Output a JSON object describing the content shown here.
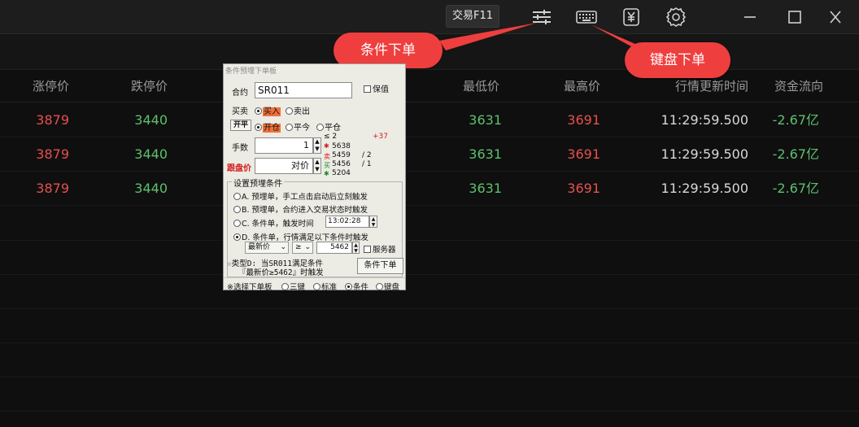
{
  "titlebar": {
    "trade_label": "交易F11",
    "icons": [
      "conditional-order-icon",
      "keyboard-icon",
      "yen-icon",
      "settings-icon",
      "minimize-icon",
      "maximize-icon",
      "close-icon"
    ]
  },
  "callouts": {
    "conditional": "条件下单",
    "keyboard": "键盘下单"
  },
  "table": {
    "headers": {
      "limit_up": "涨停价",
      "limit_down": "跌停价",
      "low": "最低价",
      "high": "最高价",
      "update_time": "行情更新时间",
      "fund_flow": "资金流向"
    },
    "rows": [
      {
        "limit_up": "3879",
        "limit_down": "3440",
        "low": "3631",
        "high": "3691",
        "update_time": "11:29:59.500",
        "fund_flow": "-2.67亿"
      },
      {
        "limit_up": "3879",
        "limit_down": "3440",
        "low": "3631",
        "high": "3691",
        "update_time": "11:29:59.500",
        "fund_flow": "-2.67亿"
      },
      {
        "limit_up": "3879",
        "limit_down": "3440",
        "low": "3631",
        "high": "3691",
        "update_time": "11:29:59.500",
        "fund_flow": "-2.67亿"
      }
    ]
  },
  "dialog": {
    "title": "条件预埋下单板",
    "contract_label": "合约",
    "contract_value": "SR011",
    "keep_label": "保值",
    "side_label": "买卖",
    "buy": "买入",
    "sell": "卖出",
    "open_btn": "开平",
    "open": "开仓",
    "close_today": "平今",
    "close": "平仓",
    "qty_label": "手数",
    "qty_value": "1",
    "price_btn": "跟盘价",
    "price_value": "对价",
    "book": {
      "le": "≤ 2",
      "diff": "+37",
      "p1": "5638",
      "p2": "5459",
      "p3": "5456",
      "p4": "5204",
      "s1": "/  2",
      "s2": "/  1",
      "tag_sell": "卖",
      "tag_buy": "买"
    },
    "group_title": "设置预埋条件",
    "option_a": "A. 预埋单，手工点击启动后立刻触发",
    "option_b": "B. 预埋单，合约进入交易状态时触发",
    "option_c": "C. 条件单，触发时间",
    "time_value": "13:02:28",
    "option_d": "D. 条件单，行情满足以下条件时触发",
    "cond_field": "最新价",
    "cond_op": "≥",
    "cond_value": "5462",
    "server_label": "服务器",
    "summary_line1": "☆类型D: 当SR011满足条件",
    "summary_line2": "『最新价≥5462』时触发",
    "submit": "条件下单",
    "panel_label": "※选择下单板",
    "panel_opts": [
      "三键",
      "标准",
      "条件",
      "键盘"
    ]
  }
}
